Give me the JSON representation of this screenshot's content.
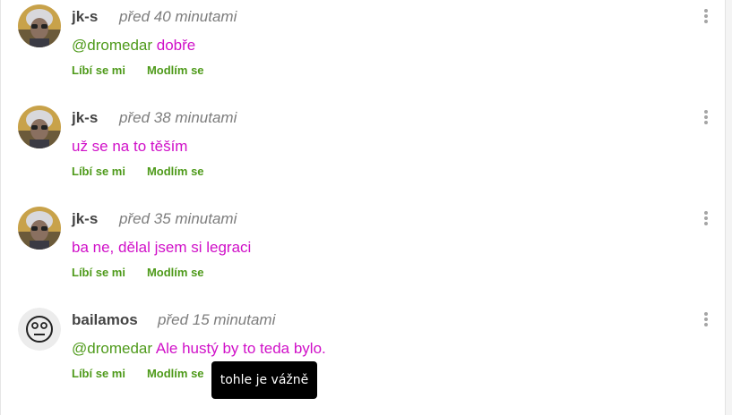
{
  "comments": [
    {
      "author": "jk-s",
      "time": "před 40 minutami",
      "mention": "@dromedar",
      "text": "dobře",
      "like_label": "Líbí se mi",
      "pray_label": "Modlím se",
      "avatar": "photo-avatar"
    },
    {
      "author": "jk-s",
      "time": "před 38 minutami",
      "mention": "",
      "text": "už se na to těším",
      "like_label": "Líbí se mi",
      "pray_label": "Modlím se",
      "avatar": "photo-avatar"
    },
    {
      "author": "jk-s",
      "time": "před 35 minutami",
      "mention": "",
      "text": "ba ne, dělal jsem si legraci",
      "like_label": "Líbí se mi",
      "pray_label": "Modlím se",
      "avatar": "photo-avatar"
    },
    {
      "author": "bailamos",
      "time": "před 15 minutami",
      "mention": "@dromedar",
      "text": "Ale hustý by to teda bylo.",
      "like_label": "Líbí se mi",
      "pray_label": "Modlím se",
      "avatar": "neutral-face-icon"
    }
  ],
  "tooltip": "tohle je vážně",
  "colors": {
    "mention": "#4e9a1a",
    "comment_text": "#d010c8",
    "action": "#4e9a1a",
    "author": "#444444",
    "time": "#7d7d7d"
  }
}
